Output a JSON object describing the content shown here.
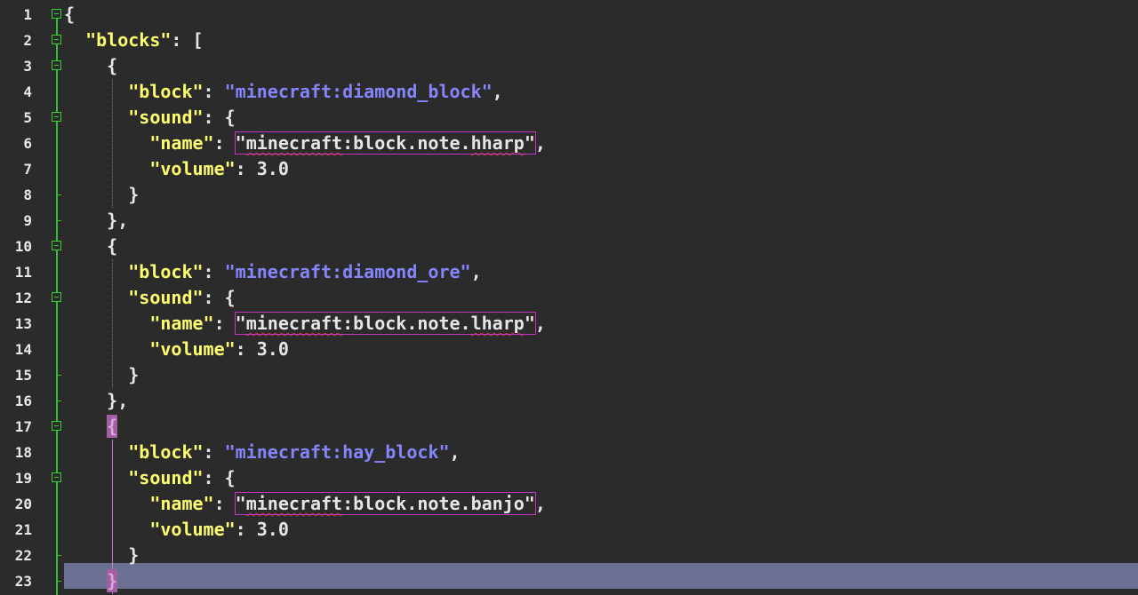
{
  "editor": {
    "line_numbers": [
      "1",
      "2",
      "3",
      "4",
      "5",
      "6",
      "7",
      "8",
      "9",
      "10",
      "11",
      "12",
      "13",
      "14",
      "15",
      "16",
      "17",
      "18",
      "19",
      "20",
      "21",
      "22",
      "23"
    ],
    "current_line": 23,
    "colors": {
      "background": "#2b2b2b",
      "key": "#ffff70",
      "string": "#8585ff",
      "punctuation": "#e6e6e6",
      "highlight_box": "#c236c2",
      "current_line": "#6b7093",
      "fold_margin": "#2fbf2f"
    },
    "lines": [
      {
        "indent": "",
        "parts": [
          {
            "t": "{",
            "c": "punc"
          }
        ]
      },
      {
        "indent": "  ",
        "parts": [
          {
            "t": "\"blocks\"",
            "c": "key"
          },
          {
            "t": ": [",
            "c": "punc"
          }
        ]
      },
      {
        "indent": "    ",
        "parts": [
          {
            "t": "{",
            "c": "punc"
          }
        ]
      },
      {
        "indent": "      ",
        "parts": [
          {
            "t": "\"block\"",
            "c": "key"
          },
          {
            "t": ": ",
            "c": "punc"
          },
          {
            "t": "\"minecraft:diamond_block\"",
            "c": "str"
          },
          {
            "t": ",",
            "c": "punc"
          }
        ]
      },
      {
        "indent": "      ",
        "parts": [
          {
            "t": "\"sound\"",
            "c": "key"
          },
          {
            "t": ": {",
            "c": "punc"
          }
        ]
      },
      {
        "indent": "        ",
        "parts": [
          {
            "t": "\"name\"",
            "c": "key"
          },
          {
            "t": ": ",
            "c": "punc"
          },
          {
            "t": "\"minecraft:block.note.hharp\"",
            "c": "boxed",
            "sq": [
              "minecraft",
              "hharp"
            ]
          },
          {
            "t": ",",
            "c": "punc"
          }
        ]
      },
      {
        "indent": "        ",
        "parts": [
          {
            "t": "\"volume\"",
            "c": "key"
          },
          {
            "t": ": ",
            "c": "punc"
          },
          {
            "t": "3.0",
            "c": "num"
          }
        ]
      },
      {
        "indent": "      ",
        "parts": [
          {
            "t": "}",
            "c": "punc"
          }
        ]
      },
      {
        "indent": "    ",
        "parts": [
          {
            "t": "},",
            "c": "punc"
          }
        ]
      },
      {
        "indent": "    ",
        "parts": [
          {
            "t": "{",
            "c": "punc"
          }
        ]
      },
      {
        "indent": "      ",
        "parts": [
          {
            "t": "\"block\"",
            "c": "key"
          },
          {
            "t": ": ",
            "c": "punc"
          },
          {
            "t": "\"minecraft:diamond_ore\"",
            "c": "str"
          },
          {
            "t": ",",
            "c": "punc"
          }
        ]
      },
      {
        "indent": "      ",
        "parts": [
          {
            "t": "\"sound\"",
            "c": "key"
          },
          {
            "t": ": {",
            "c": "punc"
          }
        ]
      },
      {
        "indent": "        ",
        "parts": [
          {
            "t": "\"name\"",
            "c": "key"
          },
          {
            "t": ": ",
            "c": "punc"
          },
          {
            "t": "\"minecraft:block.note.lharp\"",
            "c": "boxed",
            "sq": [
              "minecraft",
              "lharp"
            ]
          },
          {
            "t": ",",
            "c": "punc"
          }
        ]
      },
      {
        "indent": "        ",
        "parts": [
          {
            "t": "\"volume\"",
            "c": "key"
          },
          {
            "t": ": ",
            "c": "punc"
          },
          {
            "t": "3.0",
            "c": "num"
          }
        ]
      },
      {
        "indent": "      ",
        "parts": [
          {
            "t": "}",
            "c": "punc"
          }
        ]
      },
      {
        "indent": "    ",
        "parts": [
          {
            "t": "},",
            "c": "punc"
          }
        ]
      },
      {
        "indent": "    ",
        "parts": [
          {
            "t": "{",
            "c": "bmatch"
          }
        ]
      },
      {
        "indent": "      ",
        "parts": [
          {
            "t": "\"block\"",
            "c": "key"
          },
          {
            "t": ": ",
            "c": "punc"
          },
          {
            "t": "\"minecraft:hay_block\"",
            "c": "str"
          },
          {
            "t": ",",
            "c": "punc"
          }
        ]
      },
      {
        "indent": "      ",
        "parts": [
          {
            "t": "\"sound\"",
            "c": "key"
          },
          {
            "t": ": {",
            "c": "punc"
          }
        ]
      },
      {
        "indent": "        ",
        "parts": [
          {
            "t": "\"name\"",
            "c": "key"
          },
          {
            "t": ": ",
            "c": "punc"
          },
          {
            "t": "\"minecraft:block.note.banjo\"",
            "c": "boxed",
            "sq": [
              "minecraft"
            ]
          },
          {
            "t": ",",
            "c": "punc"
          }
        ]
      },
      {
        "indent": "        ",
        "parts": [
          {
            "t": "\"volume\"",
            "c": "key"
          },
          {
            "t": ": ",
            "c": "punc"
          },
          {
            "t": "3.0",
            "c": "num"
          }
        ]
      },
      {
        "indent": "      ",
        "parts": [
          {
            "t": "}",
            "c": "punc"
          }
        ]
      },
      {
        "indent": "    ",
        "parts": [
          {
            "t": "}",
            "c": "bmatch"
          }
        ]
      }
    ]
  }
}
